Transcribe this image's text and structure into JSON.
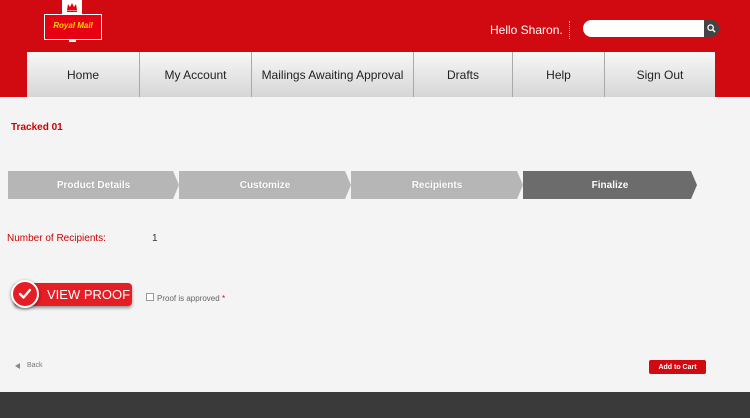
{
  "header": {
    "logo_text": "Royal Mail",
    "greeting": "Hello Sharon.",
    "search_placeholder": ""
  },
  "nav": [
    {
      "label": "Home",
      "name": "nav-home"
    },
    {
      "label": "My Account",
      "name": "nav-my-account"
    },
    {
      "label": "Mailings Awaiting Approval",
      "name": "nav-mailings-awaiting-approval"
    },
    {
      "label": "Drafts",
      "name": "nav-drafts"
    },
    {
      "label": "Help",
      "name": "nav-help"
    },
    {
      "label": "Sign Out",
      "name": "nav-sign-out"
    }
  ],
  "page_title": "Tracked 01",
  "steps": [
    {
      "label": "Product Details",
      "state": "inactive"
    },
    {
      "label": "Customize",
      "state": "inactive"
    },
    {
      "label": "Recipients",
      "state": "inactive"
    },
    {
      "label": "Finalize",
      "state": "active"
    }
  ],
  "recipients": {
    "label": "Number of Recipients:",
    "value": "1"
  },
  "view_proof": "VIEW PROOF",
  "proof_approved": {
    "label": "Proof is approved",
    "required_mark": "*"
  },
  "back": "Back",
  "add_to_cart": "Add to Cart",
  "colors": {
    "brand_red": "#d10a11",
    "active_step": "#6c6c6c",
    "inactive_step": "#b6b6b6",
    "footer": "#3a3a3a"
  }
}
